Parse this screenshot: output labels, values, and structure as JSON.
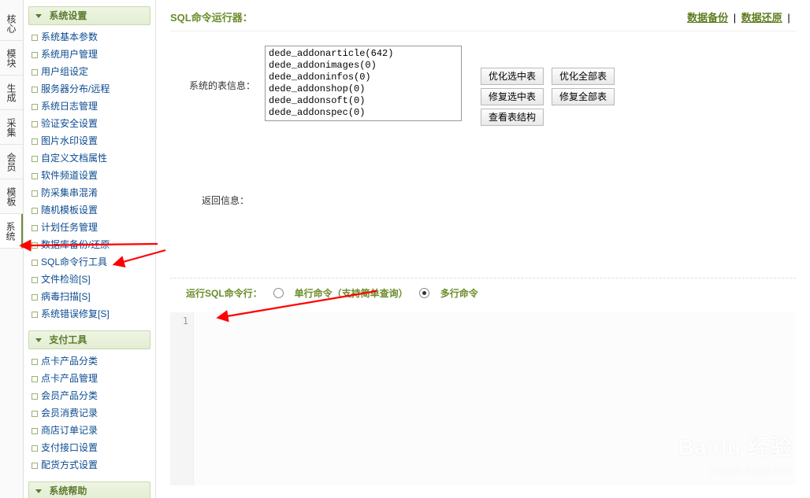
{
  "left_tabs": [
    "核心",
    "模块",
    "生成",
    "采集",
    "会员",
    "模板",
    "系统"
  ],
  "active_left_tab": 6,
  "sidebar": {
    "section1": {
      "title": "系统设置",
      "items": [
        "系统基本参数",
        "系统用户管理",
        "用户组设定",
        "服务器分布/远程",
        "系统日志管理",
        "验证安全设置",
        "图片水印设置",
        "自定义文档属性",
        "软件频道设置",
        "防采集串混淆",
        "随机模板设置",
        "计划任务管理",
        "数据库备份/还原",
        "SQL命令行工具",
        "文件检验[S]",
        "病毒扫描[S]",
        "系统错误修复[S]"
      ]
    },
    "section2": {
      "title": "支付工具",
      "items": [
        "点卡产品分类",
        "点卡产品管理",
        "会员产品分类",
        "会员消费记录",
        "商店订单记录",
        "支付接口设置",
        "配货方式设置"
      ]
    },
    "section3": {
      "title": "系统帮助"
    }
  },
  "main": {
    "title": "SQL命令运行器：",
    "top_links": [
      "数据备份",
      "数据还原"
    ],
    "table_info_label": "系统的表信息：",
    "tables": [
      "dede_addonarticle(642)",
      "dede_addonimages(0)",
      "dede_addoninfos(0)",
      "dede_addonshop(0)",
      "dede_addonsoft(0)",
      "dede_addonspec(0)"
    ],
    "buttons": {
      "opt_sel": "优化选中表",
      "opt_all": "优化全部表",
      "fix_sel": "修复选中表",
      "fix_all": "修复全部表",
      "struct": "查看表结构"
    },
    "return_label": "返回信息：",
    "run_label": "运行SQL命令行：",
    "radio_single": "单行命令（支持简单查询）",
    "radio_multi": "多行命令",
    "gutter": "1"
  },
  "watermark": {
    "brand": "Baidu 经验",
    "sub": "jingyan.baidu.com"
  }
}
